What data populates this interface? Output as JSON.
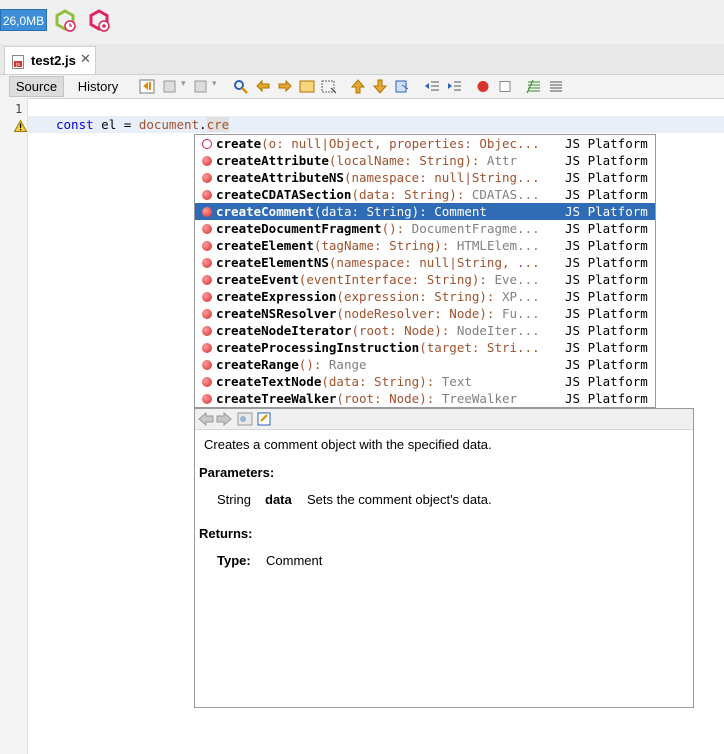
{
  "topbar": {
    "memory_label": "26,0MB",
    "icons": [
      "profiler-snapshot-icon",
      "profiler-settings-icon"
    ]
  },
  "tab": {
    "label": "test2.js",
    "close": "✕"
  },
  "editor_toolbar": {
    "source_label": "Source",
    "history_label": "History"
  },
  "editor": {
    "line_number": "1",
    "code": {
      "kw": "const",
      "var": "el",
      "op": "=",
      "obj": "document",
      "dot": ".",
      "typed": "cre"
    }
  },
  "completion": {
    "selected_index": 4,
    "items": [
      {
        "name": "create",
        "params": "(o: null|Object, properties: Objec...",
        "source": "JS Platform",
        "icon": "constructor"
      },
      {
        "name": "createAttribute",
        "params": "(localName: String): Attr",
        "source": "JS Platform",
        "icon": "method"
      },
      {
        "name": "createAttributeNS",
        "params": "(namespace: null|String...",
        "source": "JS Platform",
        "icon": "method"
      },
      {
        "name": "createCDATASection",
        "params": "(data: String): CDATAS...",
        "source": "JS Platform",
        "icon": "method"
      },
      {
        "name": "createComment",
        "params": "(data: String): Comment",
        "source": "JS Platform",
        "icon": "method"
      },
      {
        "name": "createDocumentFragment",
        "params": "(): DocumentFragme...",
        "source": "JS Platform",
        "icon": "method"
      },
      {
        "name": "createElement",
        "params": "(tagName: String): HTMLElem...",
        "source": "JS Platform",
        "icon": "method"
      },
      {
        "name": "createElementNS",
        "params": "(namespace: null|String, ...",
        "source": "JS Platform",
        "icon": "method"
      },
      {
        "name": "createEvent",
        "params": "(eventInterface: String): Eve...",
        "source": "JS Platform",
        "icon": "method"
      },
      {
        "name": "createExpression",
        "params": "(expression: String): XP...",
        "source": "JS Platform",
        "icon": "method"
      },
      {
        "name": "createNSResolver",
        "params": "(nodeResolver: Node): Fu...",
        "source": "JS Platform",
        "icon": "method"
      },
      {
        "name": "createNodeIterator",
        "params": "(root: Node): NodeIter...",
        "source": "JS Platform",
        "icon": "method"
      },
      {
        "name": "createProcessingInstruction",
        "params": "(target: Stri...",
        "source": "JS Platform",
        "icon": "method"
      },
      {
        "name": "createRange",
        "params": "(): Range",
        "source": "JS Platform",
        "icon": "method"
      },
      {
        "name": "createTextNode",
        "params": "(data: String): Text",
        "source": "JS Platform",
        "icon": "method"
      },
      {
        "name": "createTreeWalker",
        "params": "(root: Node): TreeWalker",
        "source": "JS Platform",
        "icon": "method"
      }
    ]
  },
  "documentation": {
    "description": "Creates a comment object with the specified data.",
    "parameters_heading": "Parameters:",
    "param_type": "String",
    "param_name": "data",
    "param_desc": "Sets the comment object's data.",
    "returns_heading": "Returns:",
    "type_label": "Type:",
    "type_value": "Comment"
  }
}
